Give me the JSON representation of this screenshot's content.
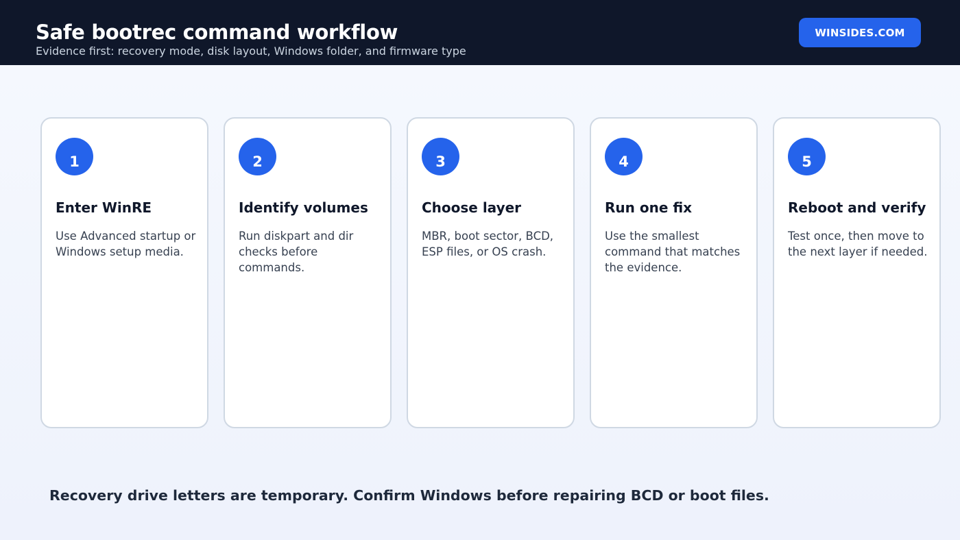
{
  "header": {
    "title": "Safe bootrec command workflow",
    "subtitle": "Evidence first: recovery mode, disk layout, Windows folder, and firmware type",
    "brand": "WINSIDES.COM"
  },
  "steps": [
    {
      "number": "1",
      "title": "Enter WinRE",
      "description": "Use Advanced startup or Windows setup media."
    },
    {
      "number": "2",
      "title": "Identify volumes",
      "description": "Run diskpart and dir checks before commands."
    },
    {
      "number": "3",
      "title": "Choose layer",
      "description": "MBR, boot sector, BCD, ESP files, or OS crash."
    },
    {
      "number": "4",
      "title": "Run one fix",
      "description": "Use the smallest command that matches the evidence."
    },
    {
      "number": "5",
      "title": "Reboot and verify",
      "description": "Test once, then move to the next layer if needed."
    }
  ],
  "footer": {
    "note": "Recovery drive letters are temporary. Confirm Windows before repairing BCD or boot files."
  },
  "colors": {
    "header_bg": "#0f172a",
    "accent": "#2563eb",
    "card_border": "#cfd8e3"
  }
}
